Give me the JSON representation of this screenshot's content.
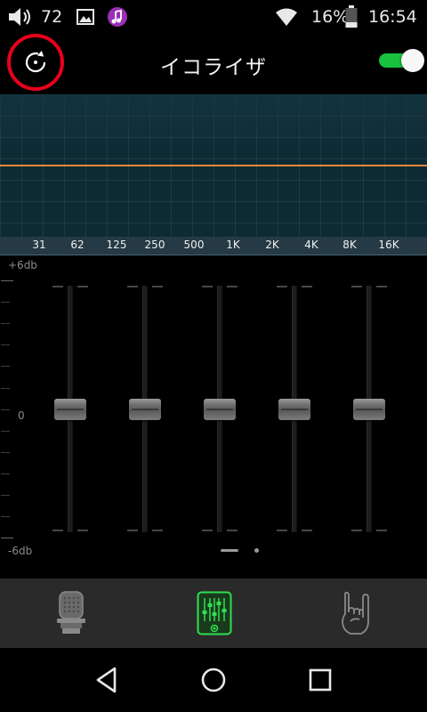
{
  "status_bar": {
    "volume_level": "72",
    "battery_percent": "16%",
    "clock": "16:54",
    "icons": [
      "volume-icon",
      "image-icon",
      "music-note-icon",
      "wifi-icon",
      "battery-icon"
    ]
  },
  "header": {
    "title": "イコライザ",
    "reset_icon": "refresh-icon",
    "enabled": true
  },
  "graph": {
    "frequencies": [
      "31",
      "62",
      "125",
      "250",
      "500",
      "1K",
      "2K",
      "4K",
      "8K",
      "16K"
    ],
    "curve_color": "#e58a3a"
  },
  "sliders": {
    "max_label": "+6db",
    "zero_label": "0",
    "min_label": "-6db",
    "levels_db": [
      0,
      0,
      0,
      0,
      0
    ],
    "page_count": 2,
    "current_page": 1
  },
  "tabs": [
    {
      "icon": "microphone-icon",
      "active": false
    },
    {
      "icon": "equalizer-icon",
      "active": true
    },
    {
      "icon": "rock-hand-icon",
      "active": false
    }
  ],
  "colors": {
    "accent_green": "#18c23e",
    "highlight_red": "#e8001c",
    "graph_bg": "#0e2a33"
  },
  "nav": [
    "back-icon",
    "home-icon",
    "recents-icon"
  ]
}
